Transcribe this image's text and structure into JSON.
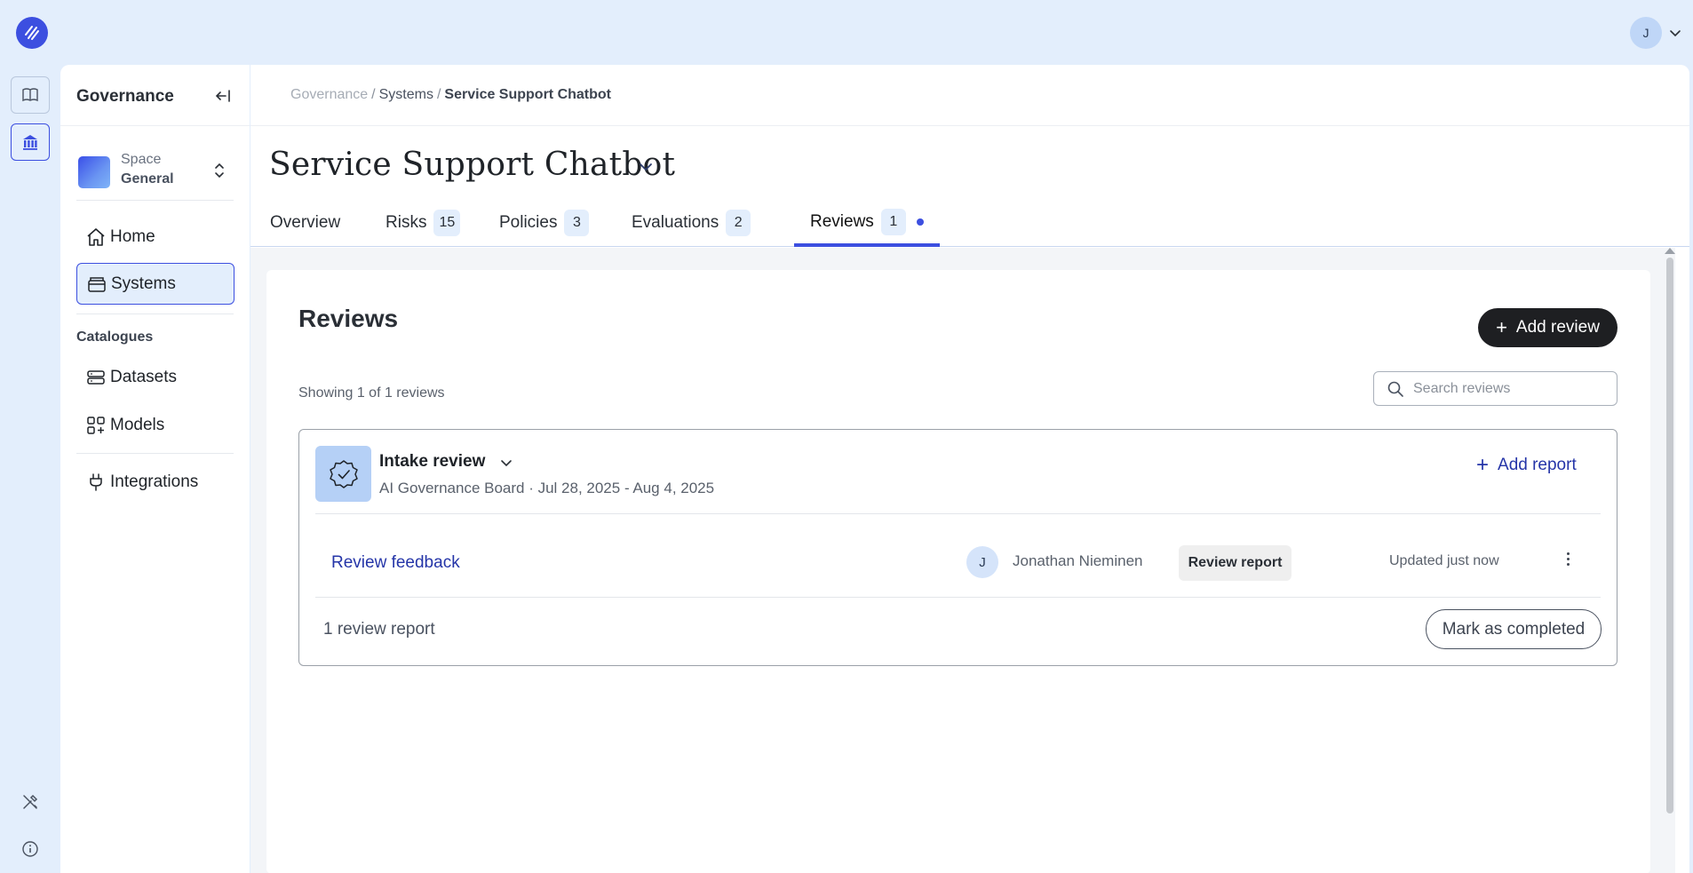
{
  "user": {
    "initial": "J"
  },
  "sidebar": {
    "title": "Governance",
    "space": {
      "kicker": "Space",
      "name": "General"
    },
    "items": [
      {
        "label": "Home",
        "icon": "home-icon"
      },
      {
        "label": "Systems",
        "icon": "systems-icon",
        "active": true
      }
    ],
    "catalogues_heading": "Catalogues",
    "catalogue_items": [
      {
        "label": "Datasets",
        "icon": "datasets-icon"
      },
      {
        "label": "Models",
        "icon": "models-icon"
      }
    ],
    "integrations": {
      "label": "Integrations",
      "icon": "plug-icon"
    }
  },
  "breadcrumb": {
    "root": "Governance",
    "section": "Systems",
    "current": "Service Support Chatbot"
  },
  "page": {
    "title": "Service Support Chatbot"
  },
  "tabs": [
    {
      "label": "Overview"
    },
    {
      "label": "Risks",
      "count": "15"
    },
    {
      "label": "Policies",
      "count": "3"
    },
    {
      "label": "Evaluations",
      "count": "2"
    },
    {
      "label": "Reviews",
      "count": "1",
      "active": true
    }
  ],
  "reviews": {
    "heading": "Reviews",
    "add_button": "Add review",
    "showing": "Showing 1 of 1 reviews",
    "search_placeholder": "Search reviews",
    "card": {
      "name": "Intake review",
      "meta": "AI Governance Board · Jul 28, 2025 - Aug 4, 2025",
      "add_report": "Add report",
      "report": {
        "title": "Review feedback",
        "reviewer_initial": "J",
        "reviewer_name": "Jonathan Nieminen",
        "type": "Review report",
        "updated": "Updated just now"
      },
      "report_count": "1 review report",
      "complete_button": "Mark as completed"
    }
  },
  "colors": {
    "accent": "#3c4fe0",
    "background": "#e3eefc",
    "dark_button": "#1e1f22",
    "link": "#2535a8"
  }
}
